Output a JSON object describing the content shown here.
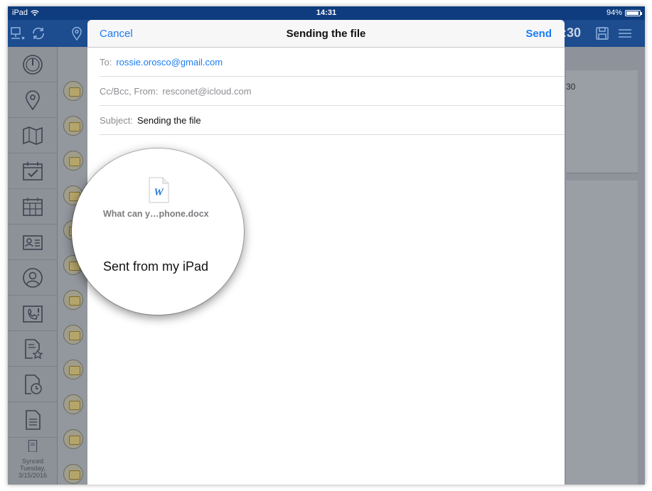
{
  "status_bar": {
    "device": "iPad",
    "time": "14:31",
    "battery": "94%",
    "battery_level": 0.94,
    "wifi_icon": "wifi-icon",
    "battery_icon": "battery-icon"
  },
  "app_bar": {
    "partial_time": ":30",
    "icons": [
      "network-icon",
      "sync-icon",
      "location-pin-icon",
      "save-icon",
      "menu-icon"
    ]
  },
  "sidebar": {
    "icons": [
      "dashboard-icon",
      "location-pin-icon",
      "map-icon",
      "calendar-check-icon",
      "calendar-icon",
      "contact-card-icon",
      "person-icon",
      "phone-alert-icon",
      "document-star-icon",
      "document-clock-icon",
      "document-icon",
      "document-list-icon"
    ],
    "synced_label": "Synced",
    "synced_day": "Tuesday,",
    "synced_date": "3/15/2016"
  },
  "right_panel": {
    "partial_value": "30",
    "partial_colon": ":"
  },
  "mail": {
    "cancel_label": "Cancel",
    "title": "Sending the file",
    "send_label": "Send",
    "to_label": "To:",
    "to_value": "rossie.orosco@gmail.com",
    "ccbcc_label": "Cc/Bcc, From:",
    "from_value": "resconet@icloud.com",
    "subject_label": "Subject:",
    "subject_value": "Sending the file",
    "attachment_name": "What can y…phone.docx",
    "attachment_icon": "word-document-icon",
    "attachment_icon_letter": "W",
    "signature": "Sent from my iPad"
  },
  "colors": {
    "status_bar": "#0e3c7e",
    "app_bar": "#1d4c8f",
    "accent": "#1a7cf2"
  }
}
